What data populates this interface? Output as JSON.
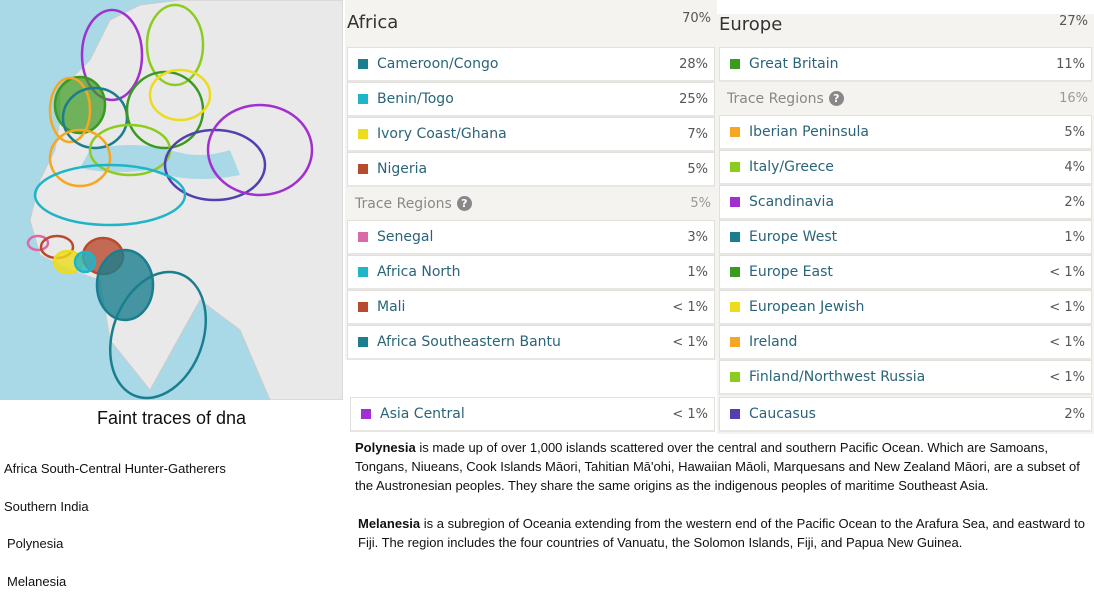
{
  "map": {
    "ocean": "#a9d8e6",
    "land": "#e9e9e9"
  },
  "caption": "Faint traces of dna",
  "faint_list": [
    "Africa South-Central Hunter-Gatherers",
    "Southern India",
    "Polynesia",
    "Melanesia"
  ],
  "africa": {
    "title": "Africa",
    "percent": "70%",
    "items": [
      {
        "label": "Cameroon/Congo",
        "percent": "28%",
        "color": "#1a7e8f"
      },
      {
        "label": "Benin/Togo",
        "percent": "25%",
        "color": "#1fb5c8"
      },
      {
        "label": "Ivory Coast/Ghana",
        "percent": "7%",
        "color": "#ecdc1a"
      },
      {
        "label": "Nigeria",
        "percent": "5%",
        "color": "#b84a2e"
      }
    ],
    "trace": {
      "label": "Trace Regions",
      "percent": "5%",
      "help_icon": "?"
    },
    "trace_items": [
      {
        "label": "Senegal",
        "percent": "3%",
        "color": "#d86aa8"
      },
      {
        "label": "Africa North",
        "percent": "1%",
        "color": "#1fb5c8"
      },
      {
        "label": "Mali",
        "percent": "< 1%",
        "color": "#b84a2e"
      },
      {
        "label": "Africa Southeastern Bantu",
        "percent": "< 1%",
        "color": "#1a7e8f"
      }
    ]
  },
  "asia": {
    "items": [
      {
        "label": "Asia Central",
        "percent": "< 1%",
        "color": "#a030d0"
      }
    ]
  },
  "europe": {
    "title": "Europe",
    "percent": "27%",
    "items": [
      {
        "label": "Great Britain",
        "percent": "11%",
        "color": "#3a9a1e"
      }
    ],
    "trace": {
      "label": "Trace Regions",
      "percent": "16%",
      "help_icon": "?"
    },
    "trace_items": [
      {
        "label": "Iberian Peninsula",
        "percent": "5%",
        "color": "#f5a623"
      },
      {
        "label": "Italy/Greece",
        "percent": "4%",
        "color": "#8ccc1e"
      },
      {
        "label": "Scandinavia",
        "percent": "2%",
        "color": "#a030d0"
      },
      {
        "label": "Europe West",
        "percent": "1%",
        "color": "#1a7e8f"
      },
      {
        "label": "Europe East",
        "percent": "< 1%",
        "color": "#3a9a1e"
      },
      {
        "label": "European Jewish",
        "percent": "< 1%",
        "color": "#ecdc1a"
      },
      {
        "label": "Ireland",
        "percent": "< 1%",
        "color": "#f5a623"
      },
      {
        "label": "Finland/Northwest Russia",
        "percent": "< 1%",
        "color": "#8ccc1e"
      },
      {
        "label": "Caucasus",
        "percent": "2%",
        "color": "#5040b0"
      }
    ]
  },
  "descriptions": [
    {
      "term": "Polynesia",
      "text": " is made up of over 1,000 islands scattered over the central and southern Pacific Ocean. Which are Samoans, Tongans, Niueans, Cook Islands Māori, Tahitian Mā'ohi, Hawaiian Māoli, Marquesans and New Zealand Māori, are a subset of the Austronesian peoples. They share the same origins as the indigenous peoples of maritime Southeast Asia."
    },
    {
      "term": "Melanesia",
      "text": " is a subregion of Oceania extending from the western end of the Pacific Ocean to the Arafura Sea, and eastward to Fiji. The region includes the four countries of Vanuatu, the Solomon Islands, Fiji, and Papua New Guinea."
    }
  ]
}
